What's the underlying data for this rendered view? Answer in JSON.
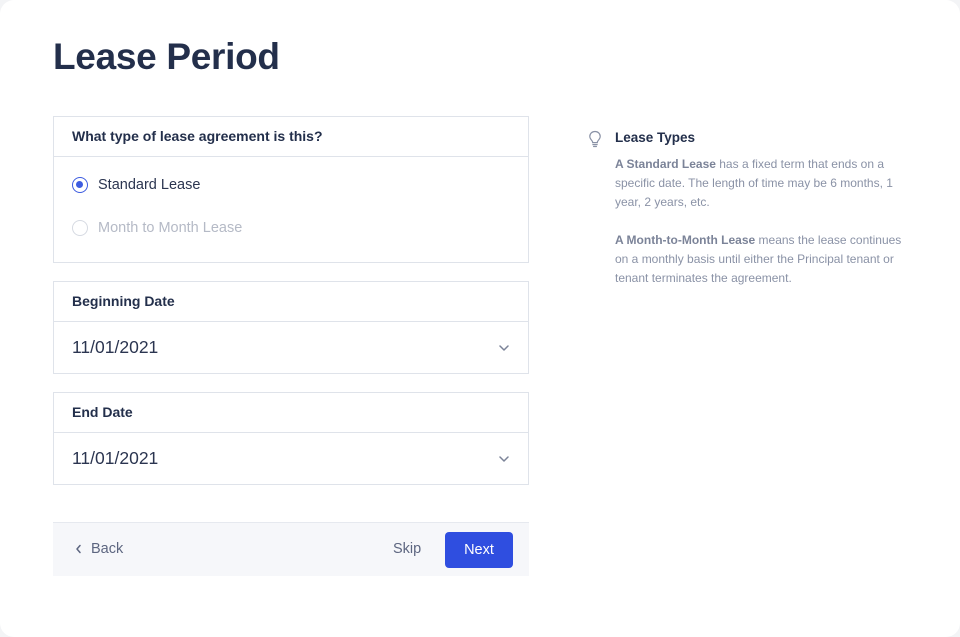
{
  "page": {
    "title": "Lease Period"
  },
  "lease_type": {
    "question": "What type of lease agreement is this?",
    "options": [
      {
        "label": "Standard Lease",
        "selected": true
      },
      {
        "label": "Month to Month Lease",
        "selected": false
      }
    ]
  },
  "beginning_date": {
    "label": "Beginning Date",
    "value": "11/01/2021"
  },
  "end_date": {
    "label": "End Date",
    "value": "11/01/2021"
  },
  "footer": {
    "back_label": "Back",
    "skip_label": "Skip",
    "next_label": "Next"
  },
  "info": {
    "icon": "lightbulb-icon",
    "title": "Lease Types",
    "standard": {
      "term": "A Standard Lease",
      "text": " has a fixed term that ends on a specific date. The length of time may be 6 months, 1 year, 2 years, etc."
    },
    "month": {
      "term": "A Month-to-Month Lease",
      "text": " means the lease continues on a monthly basis until either the Principal tenant or tenant terminates the agreement."
    }
  },
  "colors": {
    "accent": "#2f4ee0",
    "title": "#232f4b",
    "muted": "#8a92a6"
  }
}
